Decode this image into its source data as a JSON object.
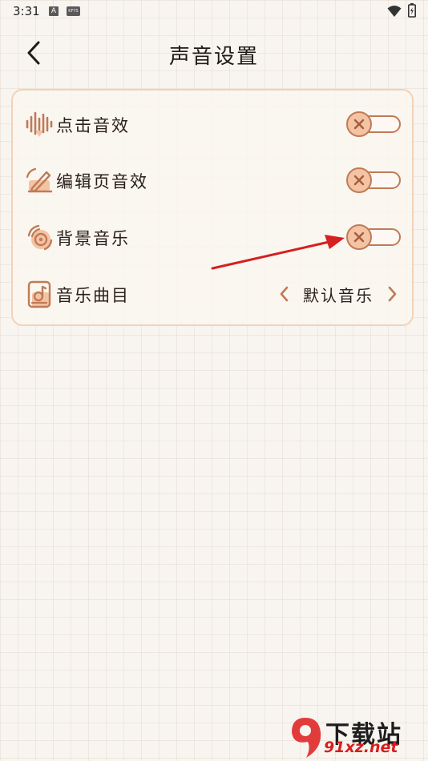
{
  "status_bar": {
    "time": "3:31",
    "icon_a_letter": "A",
    "icon_b_text": "KFYS"
  },
  "header": {
    "title": "声音设置"
  },
  "settings": {
    "rows": [
      {
        "label": "点击音效",
        "icon": "sound-wave-icon",
        "type": "toggle",
        "enabled": false
      },
      {
        "label": "编辑页音效",
        "icon": "edit-sound-icon",
        "type": "toggle",
        "enabled": false
      },
      {
        "label": "背景音乐",
        "icon": "music-disc-icon",
        "type": "toggle",
        "enabled": false
      },
      {
        "label": "音乐曲目",
        "icon": "music-track-icon",
        "type": "selector",
        "value": "默认音乐"
      }
    ]
  },
  "watermark": {
    "logo_number": "9",
    "top_text": "下载站",
    "bottom_text": "91xz.net"
  },
  "colors": {
    "accent": "#c07a57",
    "knob_fill": "#f3c3a4",
    "card_border": "#f1d3b8",
    "annotation_arrow": "#d42020",
    "background": "#f8f5f0"
  }
}
